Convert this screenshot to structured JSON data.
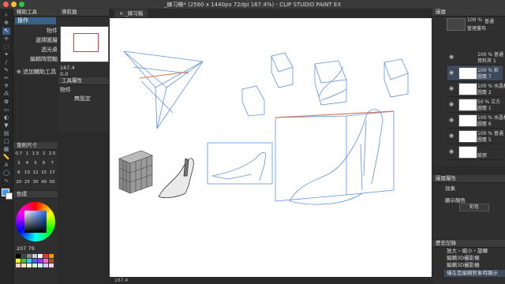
{
  "window": {
    "title": "_練习稿* (2560 x 1440px 72dpi 167.4%)  - CLIP STUDIO PAINT EX"
  },
  "left_panel": {
    "sub_tool_header": "輔助工具",
    "sub_tool_tab": "操作",
    "items": [
      "物件",
      "選擇圖層",
      "透光桌",
      "編輯時間軸"
    ],
    "add_tool_label": "追加輔助工具",
    "brush_size_header": "筆刷尺寸",
    "brush_sizes": [
      "0.7",
      "1",
      "1.5",
      "2",
      "2.5",
      "3",
      "4",
      "5",
      "6",
      "7",
      "8",
      "10",
      "12",
      "15",
      "17",
      "20",
      "25",
      "30",
      "40",
      "50"
    ],
    "color_header": "色環",
    "color_readout": "207 79"
  },
  "navigator": {
    "header": "導航器",
    "zoom": "167.4",
    "rotation": "0.0"
  },
  "tool_property": {
    "header": "工具屬性",
    "object_label": "物件",
    "no_setting": "無設定"
  },
  "canvas": {
    "tab_label": "_練习稿"
  },
  "status": {
    "zoom": "167.4"
  },
  "layers_panel": {
    "header": "圖層",
    "top_meta": [
      "100 %",
      "普通"
    ],
    "top_layer_name": "管理畫布",
    "layers": [
      {
        "pct": "100 % 普通",
        "name": "資料夾 1",
        "selected": false
      },
      {
        "pct": "100 % 影",
        "name": "圖層 7",
        "selected": true
      },
      {
        "pct": "100 % 水晶杯",
        "name": "圖層 2",
        "selected": false
      },
      {
        "pct": "50 % 立方",
        "name": "圖層 1",
        "selected": false
      },
      {
        "pct": "100 % 水晶杯",
        "name": "圖層 6",
        "selected": false
      },
      {
        "pct": "100 % 普通",
        "name": "圖層 5",
        "selected": false
      },
      {
        "pct": "",
        "name": "紙張",
        "selected": false
      }
    ]
  },
  "layer_property": {
    "header": "圖層屬性",
    "effect_label": "效果",
    "display_color_label": "顯示顏色",
    "display_color_value": "彩色"
  },
  "history": {
    "header": "歷史記錄",
    "items": [
      "放大・縮小・旋轉",
      "編輯3D攝影機",
      "編輯3D攝影機",
      "僅在是編輯對象時顯示"
    ]
  },
  "colors": {
    "accent": "#3b9cff",
    "sketch_blue": "#5b93e0",
    "sketch_red": "#e8703a"
  }
}
